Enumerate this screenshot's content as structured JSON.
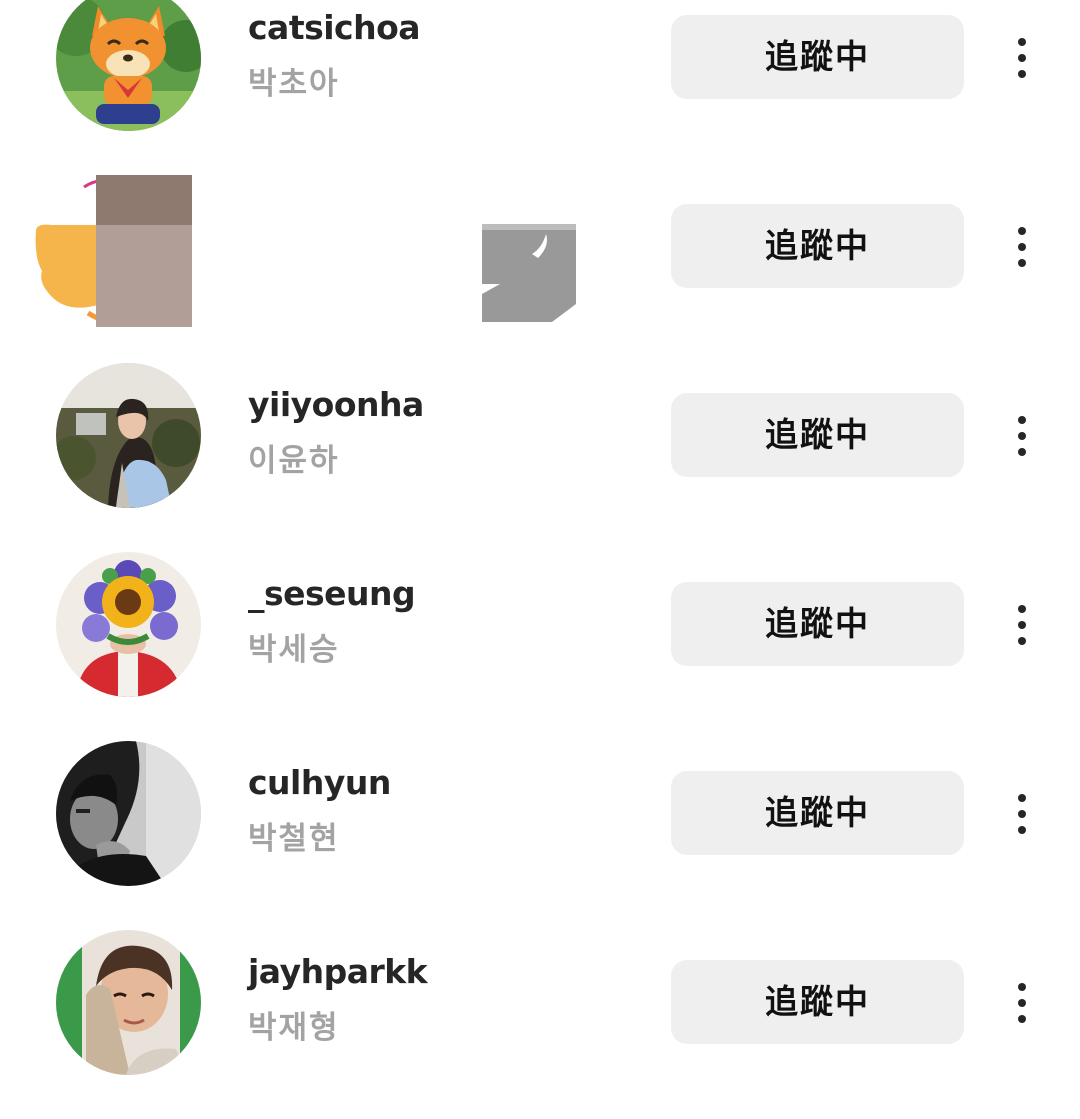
{
  "following_list": [
    {
      "username": "catsichoa",
      "full_name": "박초아",
      "button_label": "追蹤中",
      "avatar_icon": "fox-avatar-icon"
    },
    {
      "username": "",
      "full_name": "",
      "button_label": "追蹤中",
      "avatar_icon": "censored-avatar-icon"
    },
    {
      "username": "yiiyoonha",
      "full_name": "이윤하",
      "button_label": "追蹤中",
      "avatar_icon": "person-photo-icon"
    },
    {
      "username": "_seseung",
      "full_name": "박세승",
      "button_label": "追蹤中",
      "avatar_icon": "sunflower-photo-icon"
    },
    {
      "username": "culhyun",
      "full_name": "박철현",
      "button_label": "追蹤中",
      "avatar_icon": "bw-portrait-icon"
    },
    {
      "username": "jayhparkk",
      "full_name": "박재형",
      "button_label": "追蹤中",
      "avatar_icon": "person-photo-icon"
    }
  ],
  "colors": {
    "button_bg": "#efefef",
    "username": "#262626",
    "full_name": "#a3a3a3"
  }
}
